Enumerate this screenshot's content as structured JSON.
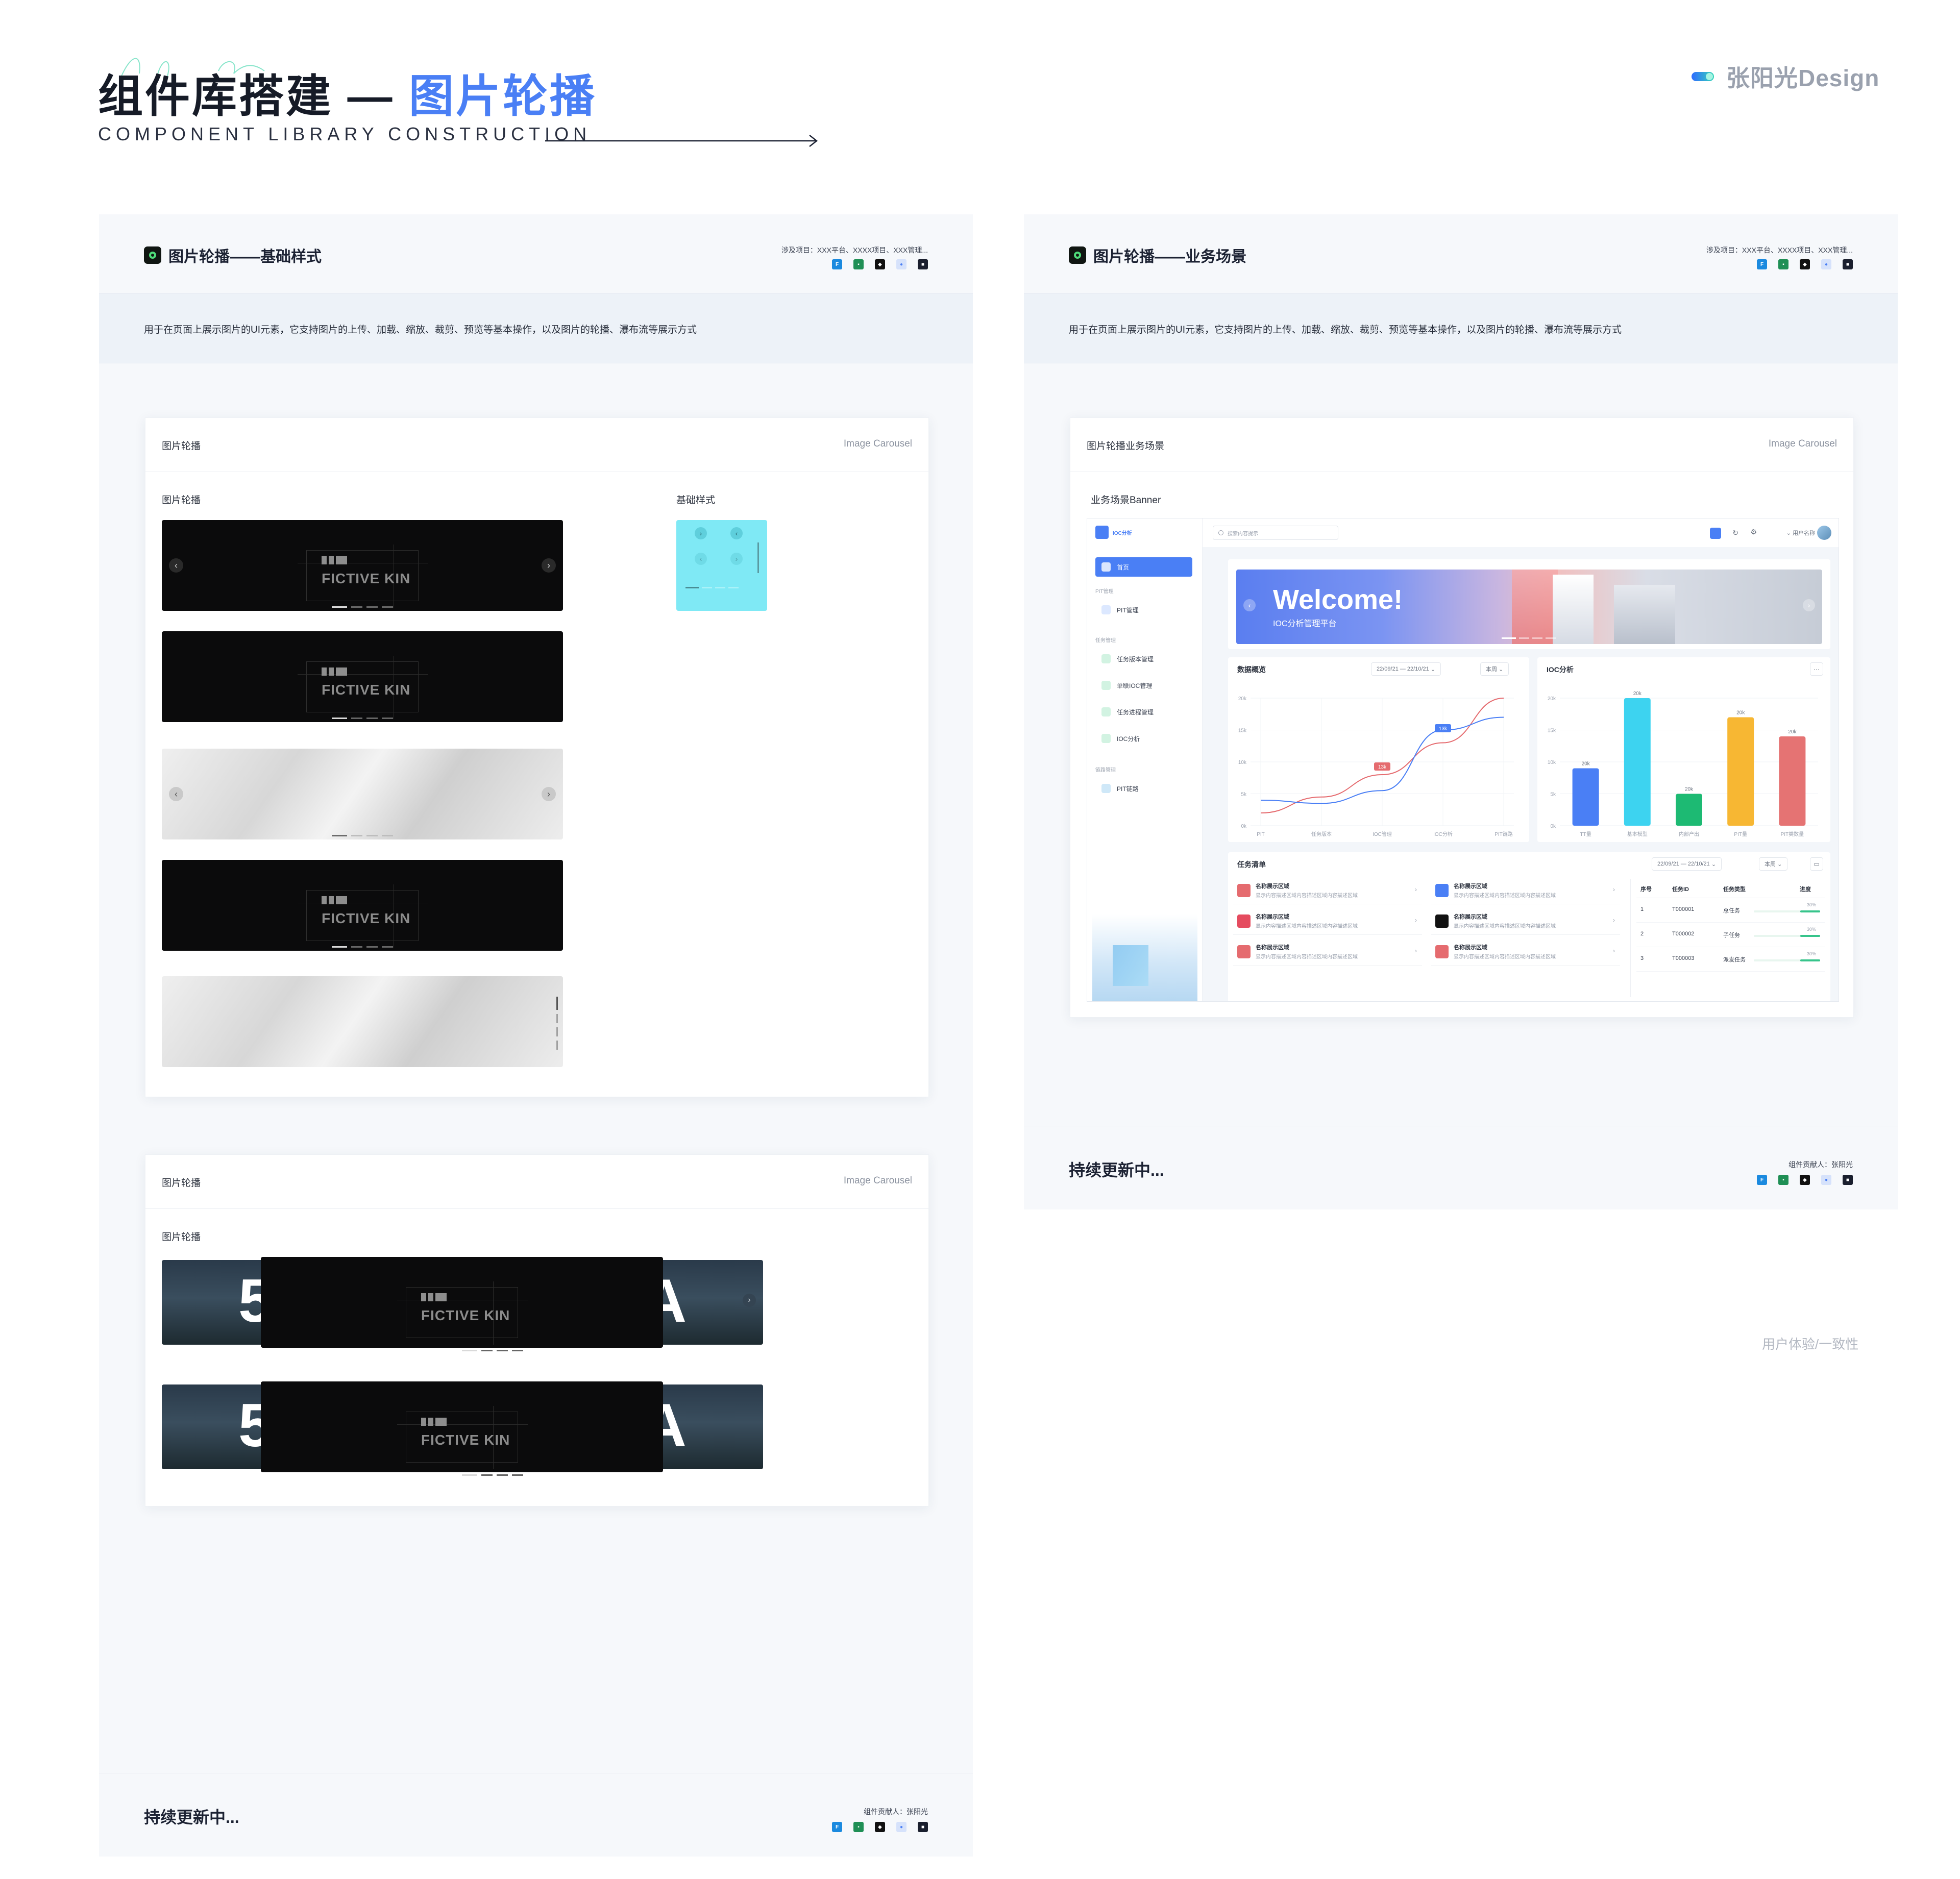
{
  "header": {
    "title_main": "组件库搭建 — ",
    "title_highlight": "图片轮播",
    "subtitle": "COMPONENT LIBRARY CONSTRUCTION",
    "brand": "张阳光Design"
  },
  "left_panel": {
    "title": "图片轮播——基础样式",
    "meta": "涉及项目：XXX平台、XXXX项目、XXX管理...",
    "desc": "用于在页面上展示图片的UI元素，它支持图片的上传、加载、缩放、裁剪、预览等基本操作，以及图片的轮播、瀑布流等展示方式",
    "card1": {
      "title": "图片轮播",
      "en": "Image Carousel",
      "label_left": "图片轮播",
      "label_right": "基础样式",
      "brand_text": "FICTIVE KIN"
    },
    "card2": {
      "title": "图片轮播",
      "en": "Image Carousel",
      "label": "图片轮播",
      "brand_text": "FICTIVE KIN"
    },
    "footer": "持续更新中...",
    "contributor": "组件贡献人：张阳光"
  },
  "right_panel": {
    "title": "图片轮播——业务场景",
    "meta": "涉及项目：XXX平台、XXXX项目、XXX管理...",
    "desc": "用于在页面上展示图片的UI元素，它支持图片的上传、加载、缩放、裁剪、预览等基本操作，以及图片的轮播、瀑布流等展示方式",
    "card": {
      "title": "图片轮播业务场景",
      "en": "Image Carousel",
      "label": "业务场景Banner"
    },
    "footer": "持续更新中...",
    "contributor": "组件贡献人：张阳光"
  },
  "dashboard": {
    "logo": "IOC分析",
    "search_placeholder": "搜索内容提示",
    "user": "用户名称",
    "sidebar": [
      {
        "section": "",
        "label": "首页"
      },
      {
        "section": "PIT管理",
        "label": "PIT管理"
      },
      {
        "section": "任务管理",
        "label": "任务版本管理"
      },
      {
        "section": "",
        "label": "单联IOC管理"
      },
      {
        "section": "",
        "label": "任务进程管理"
      },
      {
        "section": "",
        "label": "IOC分析"
      },
      {
        "section": "链路管理",
        "label": "PIT链路"
      }
    ],
    "banner_title": "Welcome!",
    "banner_sub": "IOC分析管理平台",
    "overview": {
      "title": "数据概览",
      "date": "22/09/21 — 22/10/21",
      "period": "本周"
    },
    "ioc": {
      "title": "IOC分析"
    },
    "tasks": {
      "title": "任务清单",
      "date": "22/09/21 — 22/10/21",
      "period": "本周",
      "item_title": "名称展示区域",
      "item_desc": "显示内容描述区域内容描述区域内容描述区域",
      "table_headers": [
        "序号",
        "任务ID",
        "任务类型",
        "进度"
      ],
      "rows": [
        [
          "1",
          "T000001",
          "总任务",
          "30%"
        ],
        [
          "2",
          "T000002",
          "子任务",
          "30%"
        ],
        [
          "3",
          "T000003",
          "派发任务",
          "30%"
        ]
      ]
    }
  },
  "chart_data": [
    {
      "type": "line",
      "title": "数据概览",
      "categories": [
        "PIT",
        "任务版本",
        "IOC管理",
        "IOC分析",
        "PIT链路"
      ],
      "ylim": [
        0,
        20000
      ],
      "yticks": [
        "0k",
        "5k",
        "10k",
        "15k",
        "20k"
      ],
      "series": [
        {
          "values": [
            2000,
            4500,
            8000,
            13000,
            20000
          ]
        },
        {
          "values": [
            4000,
            3500,
            5500,
            15000,
            17000
          ]
        }
      ],
      "annotations": [
        "13k",
        "13k"
      ]
    },
    {
      "type": "bar",
      "title": "IOC分析",
      "categories": [
        "TT量",
        "基本模型",
        "内部产出",
        "PIT量",
        "PIT类数量"
      ],
      "values": [
        9000,
        20000,
        5000,
        17000,
        14000
      ],
      "labels": [
        "20k",
        "20k",
        "20k",
        "20k",
        "20k"
      ],
      "ylim": [
        0,
        20000
      ],
      "yticks": [
        "0k",
        "5k",
        "10k",
        "15k",
        "20k"
      ],
      "colors": [
        "#4a7ff5",
        "#3dd3f0",
        "#1dba73",
        "#f7b733",
        "#e57373"
      ]
    }
  ],
  "right_note": "用户体验/一致性",
  "chips": [
    "#1b8adf",
    "#1f8f55",
    "#111111",
    "#5b8def",
    "#1a1f2e"
  ]
}
